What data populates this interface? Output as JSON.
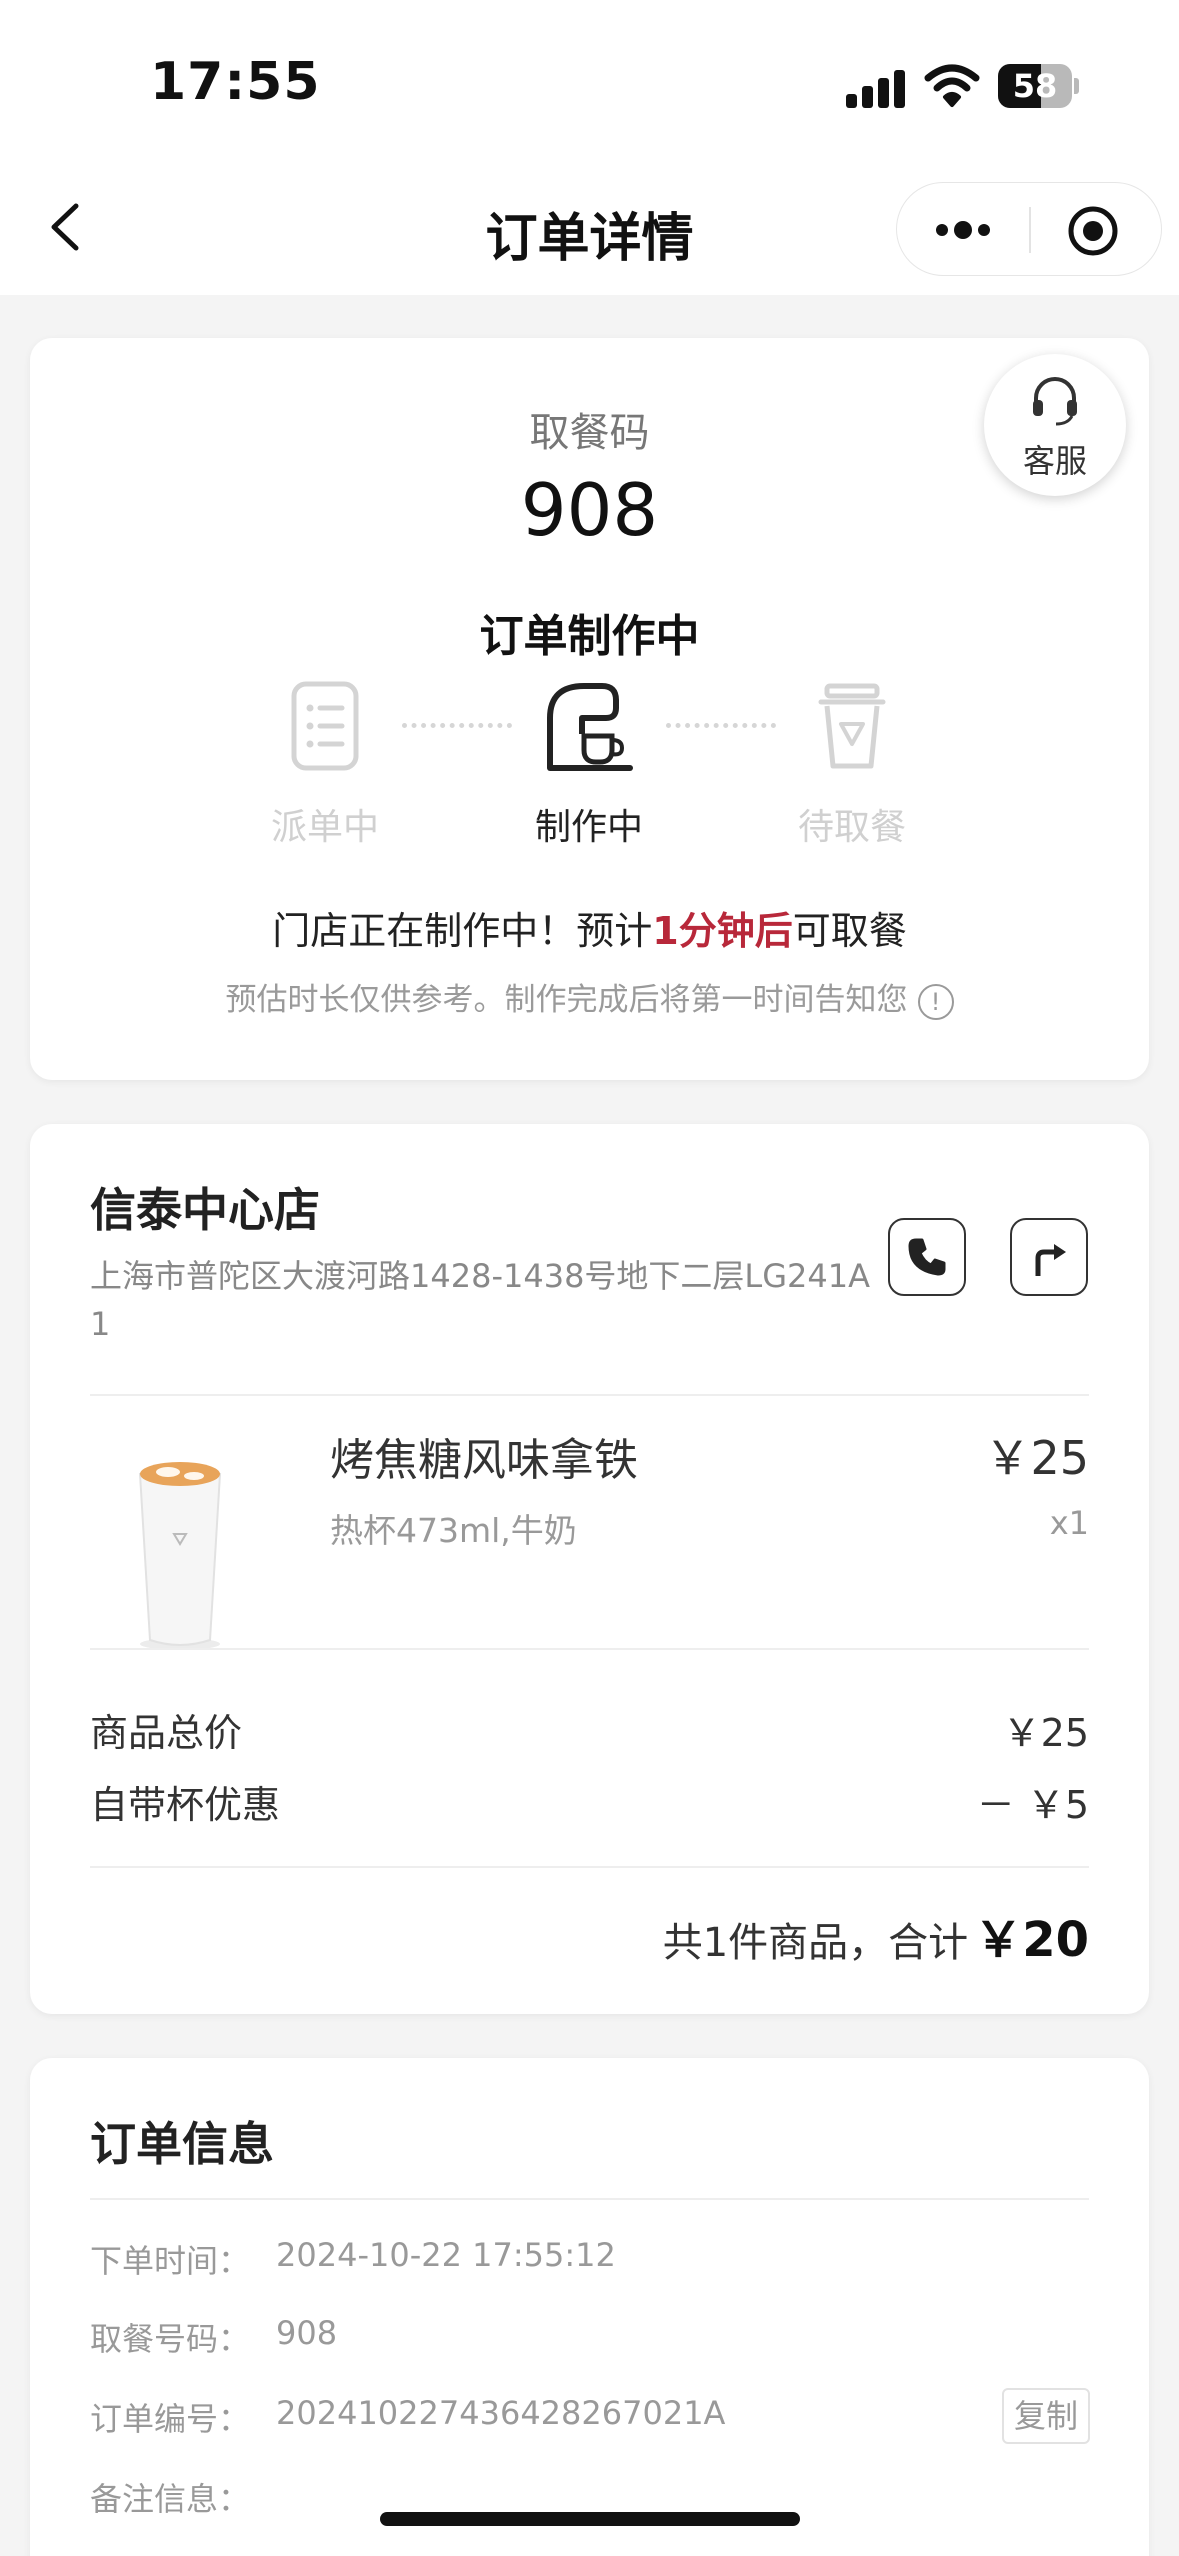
{
  "status_bar": {
    "time": "17:55",
    "battery": "58",
    "battery_level": 0.58
  },
  "nav": {
    "title": "订单详情",
    "back_icon": "chevron-left-icon",
    "more_icon": "more-dots-icon",
    "close_icon": "target-circle-icon"
  },
  "status_card": {
    "service_label": "客服",
    "pick_label": "取餐码",
    "pick_code": "908",
    "order_status": "订单制作中",
    "steps": [
      {
        "label": "派单中",
        "icon": "order-list-icon",
        "active": false
      },
      {
        "label": "制作中",
        "icon": "coffee-machine-icon",
        "active": true
      },
      {
        "label": "待取餐",
        "icon": "takeaway-cup-icon",
        "active": false
      }
    ],
    "message_prefix": "门店正在制作中！预计",
    "message_highlight": "1分钟后",
    "message_suffix": "可取餐",
    "note": "预估时长仅供参考。制作完成后将第一时间告知您",
    "note_icon": "info-icon",
    "accent_color": "#b8283a"
  },
  "store_card": {
    "store_name": "信泰中心店",
    "address": "上海市普陀区大渡河路1428-1438号地下二层LG241A1",
    "phone_icon": "phone-icon",
    "nav_icon": "directions-icon",
    "product": {
      "name": "烤焦糖风味拿铁",
      "spec": "热杯473ml,牛奶",
      "price": "￥25",
      "qty": "x1"
    },
    "subtotal_label": "商品总价",
    "subtotal_value": "￥25",
    "discount_label": "自带杯优惠",
    "discount_value": "－ ￥5",
    "total_prefix": "共1件商品，合计",
    "total_value": "￥20"
  },
  "info_card": {
    "title": "订单信息",
    "rows": [
      {
        "label": "下单时间：",
        "value": "2024-10-22 17:55:12"
      },
      {
        "label": "取餐号码：",
        "value": "908"
      },
      {
        "label": "订单编号：",
        "value": "202410227436428267021A"
      },
      {
        "label": "备注信息：",
        "value": ""
      }
    ],
    "copy_label": "复制"
  }
}
